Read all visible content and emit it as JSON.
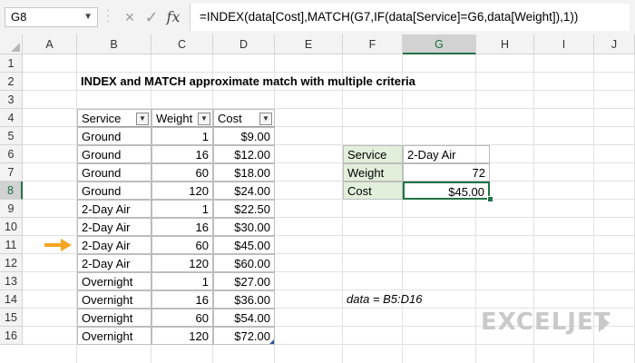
{
  "formula_bar": {
    "name_box": "G8",
    "cancel_icon": "×",
    "enter_icon": "✓",
    "fx_label": "fx",
    "formula": "=INDEX(data[Cost],MATCH(G7,IF(data[Service]=G6,data[Weight]),1))"
  },
  "columns": [
    "A",
    "B",
    "C",
    "D",
    "E",
    "F",
    "G",
    "H",
    "I",
    "J"
  ],
  "rows": [
    "1",
    "2",
    "3",
    "4",
    "5",
    "6",
    "7",
    "8",
    "9",
    "10",
    "11",
    "12",
    "13",
    "14",
    "15",
    "16"
  ],
  "selected_cell": {
    "column": "G",
    "row": "8"
  },
  "title": "INDEX and MATCH approximate match with multiple criteria",
  "table": {
    "headers": [
      "Service",
      "Weight",
      "Cost"
    ],
    "filter_icon": "chevron-down-icon",
    "rows": [
      [
        "Ground",
        "1",
        "$9.00"
      ],
      [
        "Ground",
        "16",
        "$12.00"
      ],
      [
        "Ground",
        "60",
        "$18.00"
      ],
      [
        "Ground",
        "120",
        "$24.00"
      ],
      [
        "2-Day Air",
        "1",
        "$22.50"
      ],
      [
        "2-Day Air",
        "16",
        "$30.00"
      ],
      [
        "2-Day Air",
        "60",
        "$45.00"
      ],
      [
        "2-Day Air",
        "120",
        "$60.00"
      ],
      [
        "Overnight",
        "1",
        "$27.00"
      ],
      [
        "Overnight",
        "16",
        "$36.00"
      ],
      [
        "Overnight",
        "60",
        "$54.00"
      ],
      [
        "Overnight",
        "120",
        "$72.00"
      ]
    ]
  },
  "lookup": {
    "labels": [
      "Service",
      "Weight",
      "Cost"
    ],
    "values": [
      "2-Day Air",
      "72",
      "$45.00"
    ]
  },
  "note": "data = B5:D16",
  "highlight_arrow_row": "11",
  "brand": "EXCELJET",
  "colors": {
    "accent": "#217346",
    "arrow": "#f5a623",
    "input_fill": "#e2efda"
  }
}
